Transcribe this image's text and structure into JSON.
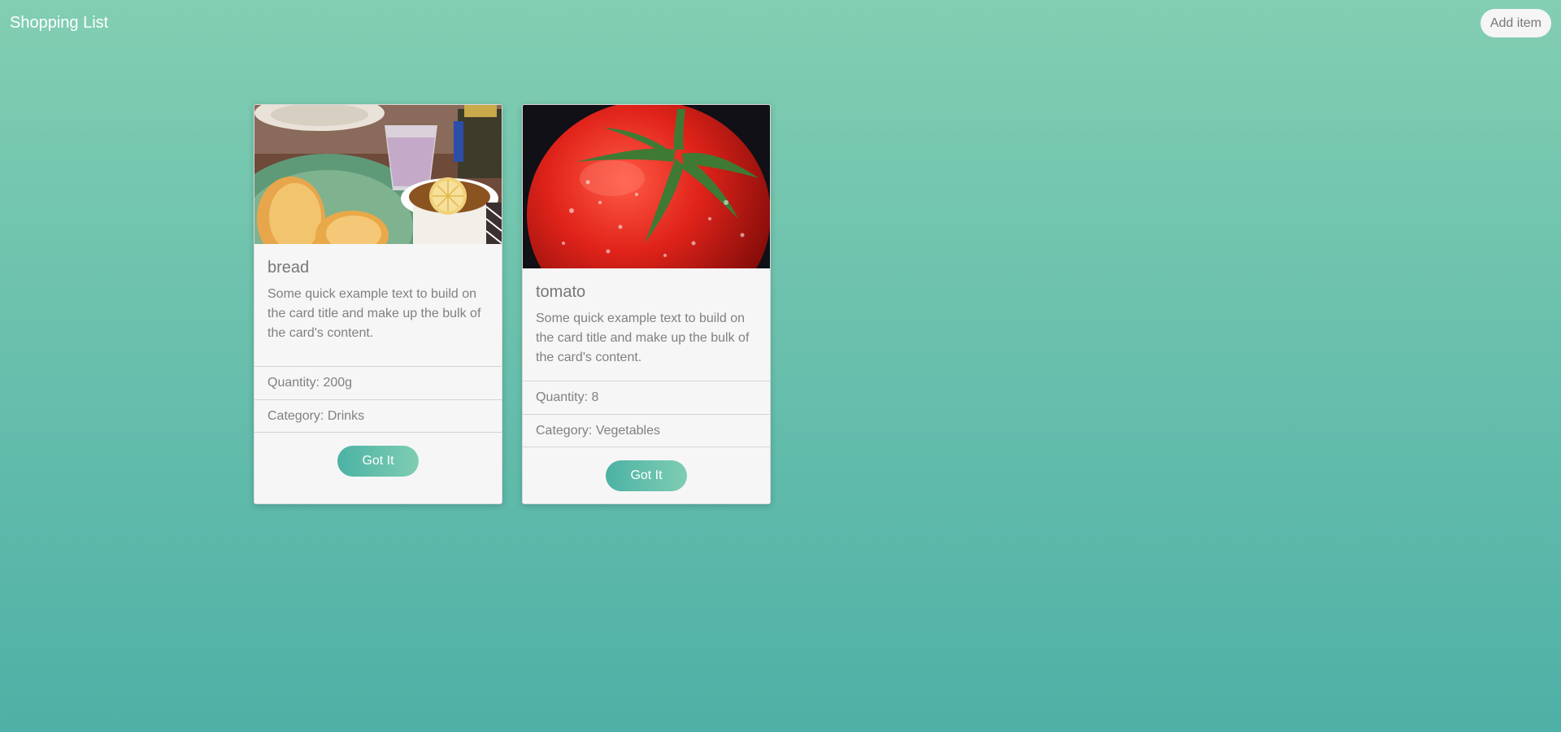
{
  "header": {
    "title": "Shopping List",
    "add_button_label": "Add item"
  },
  "cards": [
    {
      "title": "bread",
      "text": "Some quick example text to build on the card title and make up the bulk of the card's content.",
      "quantity": "Quantity: 200g",
      "category": "Category: Drinks",
      "button_label": "Got It",
      "image": "breakfast-photo"
    },
    {
      "title": "tomato",
      "text": "Some quick example text to build on the card title and make up the bulk of the card's content.",
      "quantity": "Quantity: 8",
      "category": "Category: Vegetables",
      "button_label": "Got It",
      "image": "tomato-photo"
    }
  ],
  "colors": {
    "background_top": "#82ceb2",
    "background_bottom": "#4eb0a6",
    "card_bg": "#f6f6f6",
    "button_gradient_start": "#4cb2a4",
    "button_gradient_end": "#7fcdb3"
  }
}
